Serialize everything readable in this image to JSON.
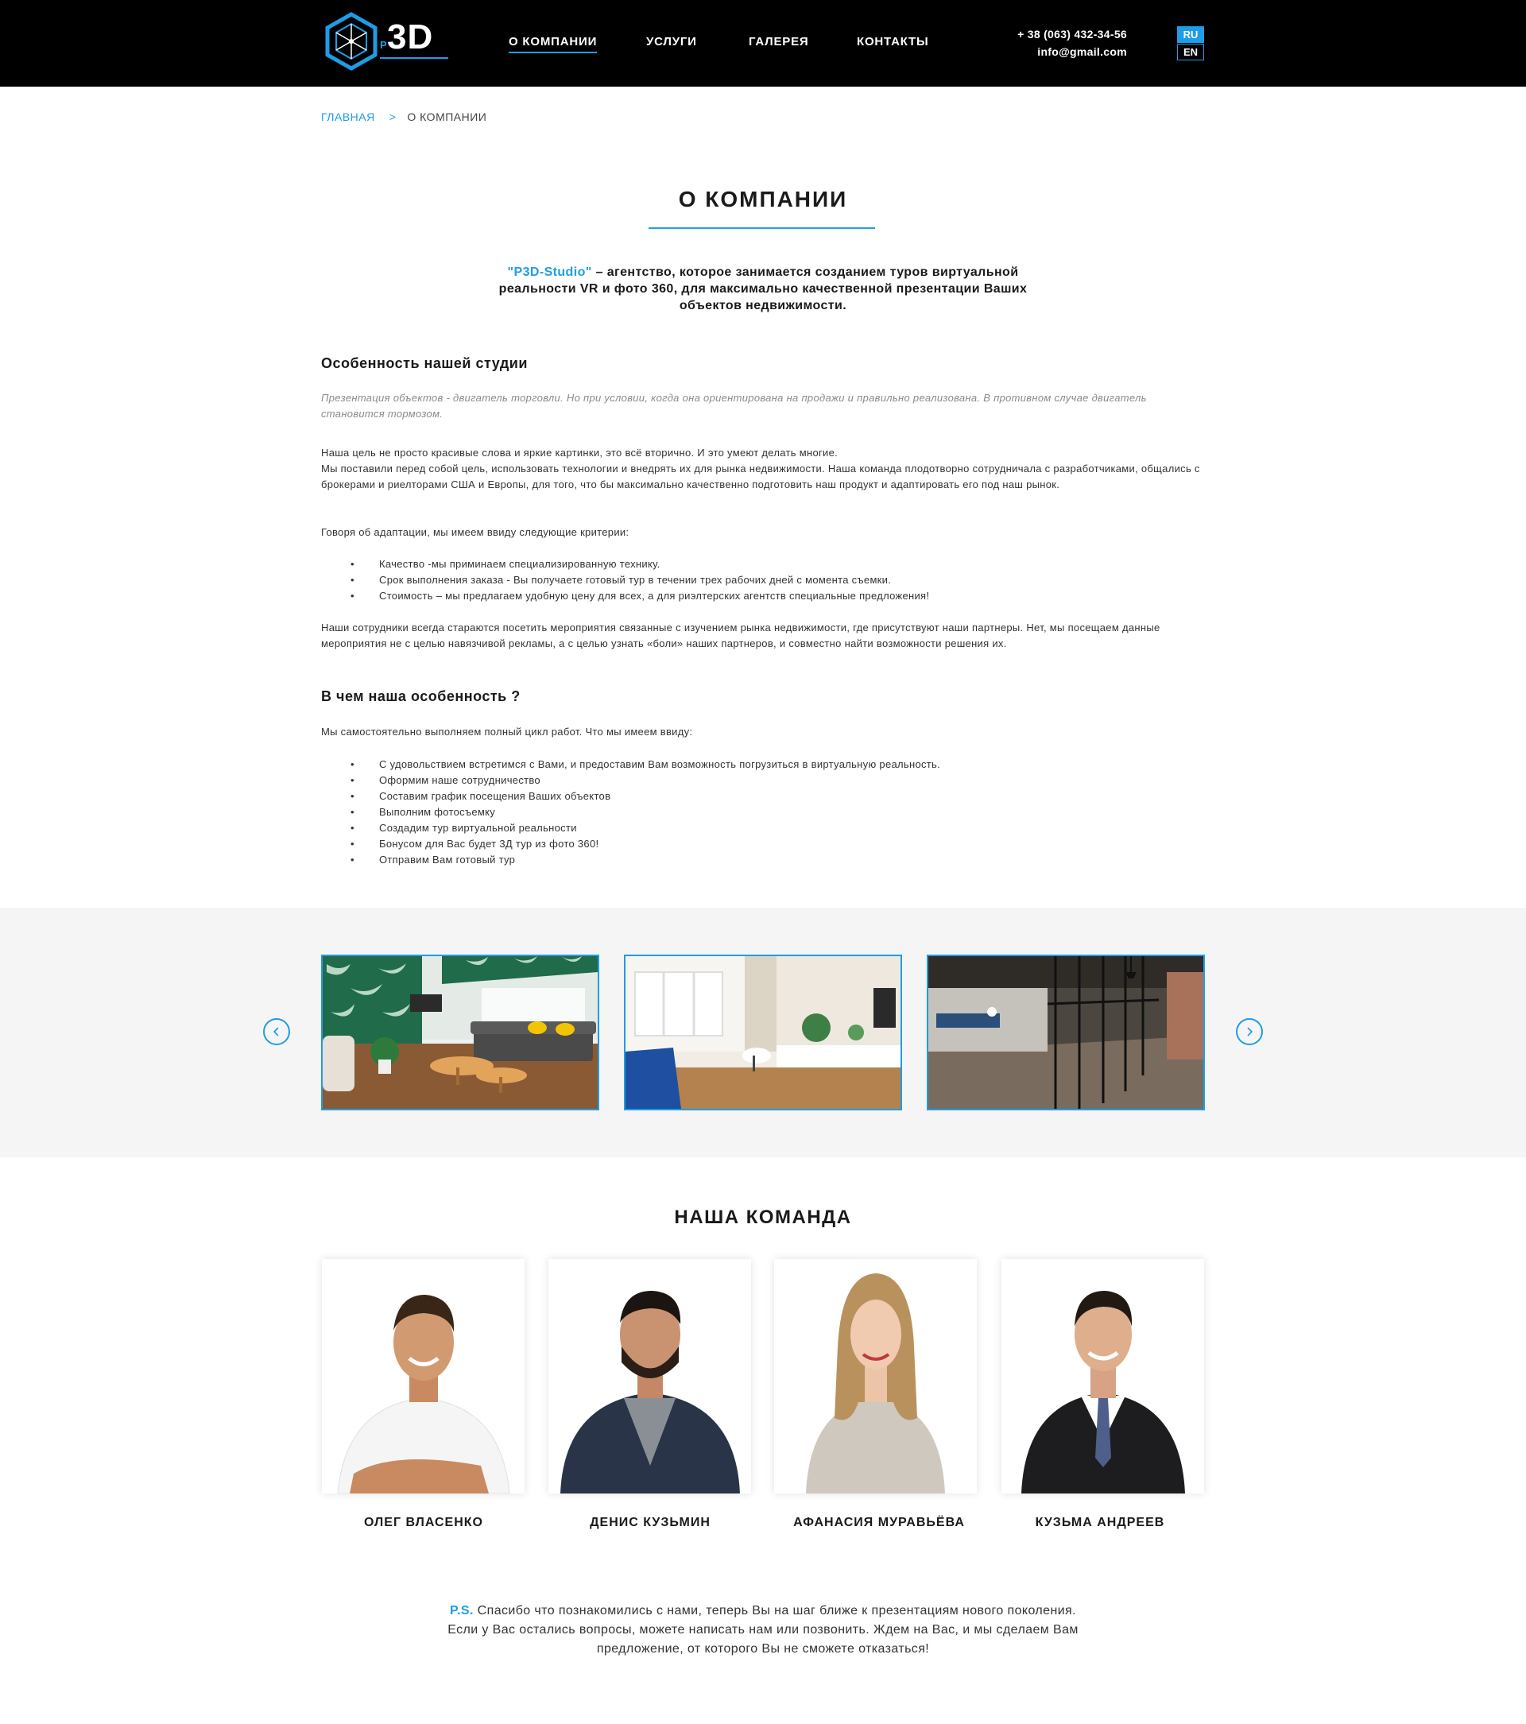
{
  "header": {
    "logo_text_p": "P",
    "logo_text_rest": "3D",
    "nav": [
      {
        "label": "О КОМПАНИИ",
        "active": true
      },
      {
        "label": "УСЛУГИ"
      },
      {
        "label": "ГАЛЕРЕЯ"
      },
      {
        "label": "КОНТАКТЫ"
      }
    ],
    "phone": "+ 38 (063) 432-34-56",
    "email": "info@gmail.com",
    "lang": [
      "RU",
      "EN"
    ]
  },
  "breadcrumb": {
    "home": "ГЛАВНАЯ",
    "separator": ">",
    "current": "О КОМПАНИИ"
  },
  "page_title": "О КОМПАНИИ",
  "intro": {
    "brand": "\"P3D-Studio\"",
    "text": " – агентство, которое занимается созданием туров виртуальной реальности VR и фото 360, для максимально качественной презентации Ваших объектов недвижимости."
  },
  "section1": {
    "heading": "Особенность нашей студии",
    "italic": "Презентация объектов - двигатель торговли. Но при условии, когда она ориентирована на продажи и правильно реализована. В противном случае двигатель становится тормозом.",
    "p1_line1": "Наша цель не просто красивые слова и яркие картинки, это всё вторично. И это умеют делать многие.",
    "p1_line2": "Мы поставили перед собой цель, использовать технологии и внедрять их для рынка недвижимости. Наша команда плодотворно сотрудничала с разработчиками, общались с брокерами и риелторами США и Европы, для того, что бы максимально качественно подготовить наш продукт и адаптировать его под наш рынок.",
    "p2": "Говоря об адаптации, мы имеем ввиду следующие критерии:",
    "criteria": [
      "Качество -мы приминаем специализированную технику.",
      "Срок выполнения заказа - Вы получаете готовый тур в течении трех рабочих дней с момента съемки.",
      "Стоимость – мы предлагаем удобную цену для всех, а для риэлтерских агентств специальные предложения!"
    ],
    "p3": "Наши сотрудники всегда стараются посетить мероприятия связанные с изучением рынка недвижимости, где присутствуют наши партнеры. Нет, мы посещаем данные мероприятия не с целью навязчивой рекламы, а с целью узнать «боли» наших партнеров, и совместно найти возможности решения их."
  },
  "section2": {
    "heading": "В чем наша особенность ?",
    "p": "Мы самостоятельно выполняем полный цикл работ. Что мы имеем ввиду:",
    "steps": [
      "С удовольствием встретимся с Вами, и предоставим Вам возможность погрузиться в виртуальную реальность.",
      "Оформим наше сотрудничество",
      "Составим график посещения Ваших объектов",
      "Выполним фотосъемку",
      "Создадим тур виртуальной реальности",
      "Бонусом для Вас будет 3Д тур из фото 360!",
      "Отправим Вам готовый тур"
    ]
  },
  "gallery": {
    "images": [
      "living-room-tropical-wallpaper",
      "white-living-room-blue-sofa",
      "glass-office-corridor"
    ]
  },
  "team": {
    "title": "НАША КОМАНДА",
    "members": [
      {
        "name": "ОЛЕГ ВЛАСЕНКО"
      },
      {
        "name": "ДЕНИС КУЗЬМИН"
      },
      {
        "name": "АФАНАСИЯ МУРАВЬЁВА"
      },
      {
        "name": "КУЗЬМА АНДРЕЕВ"
      }
    ]
  },
  "ps": {
    "label": "P.S.",
    "text": " Спасибо что познакомились с нами, теперь Вы на шаг ближе к презентациям нового поколения. Если у Вас остались вопросы, можете написать нам или позвонить. Ждем на Вас, и мы сделаем Вам предложение, от которого Вы не сможете отказаться!"
  },
  "colors": {
    "accent": "#1e9de6",
    "header_bg": "#000000",
    "gallery_bg": "#f5f5f5"
  }
}
